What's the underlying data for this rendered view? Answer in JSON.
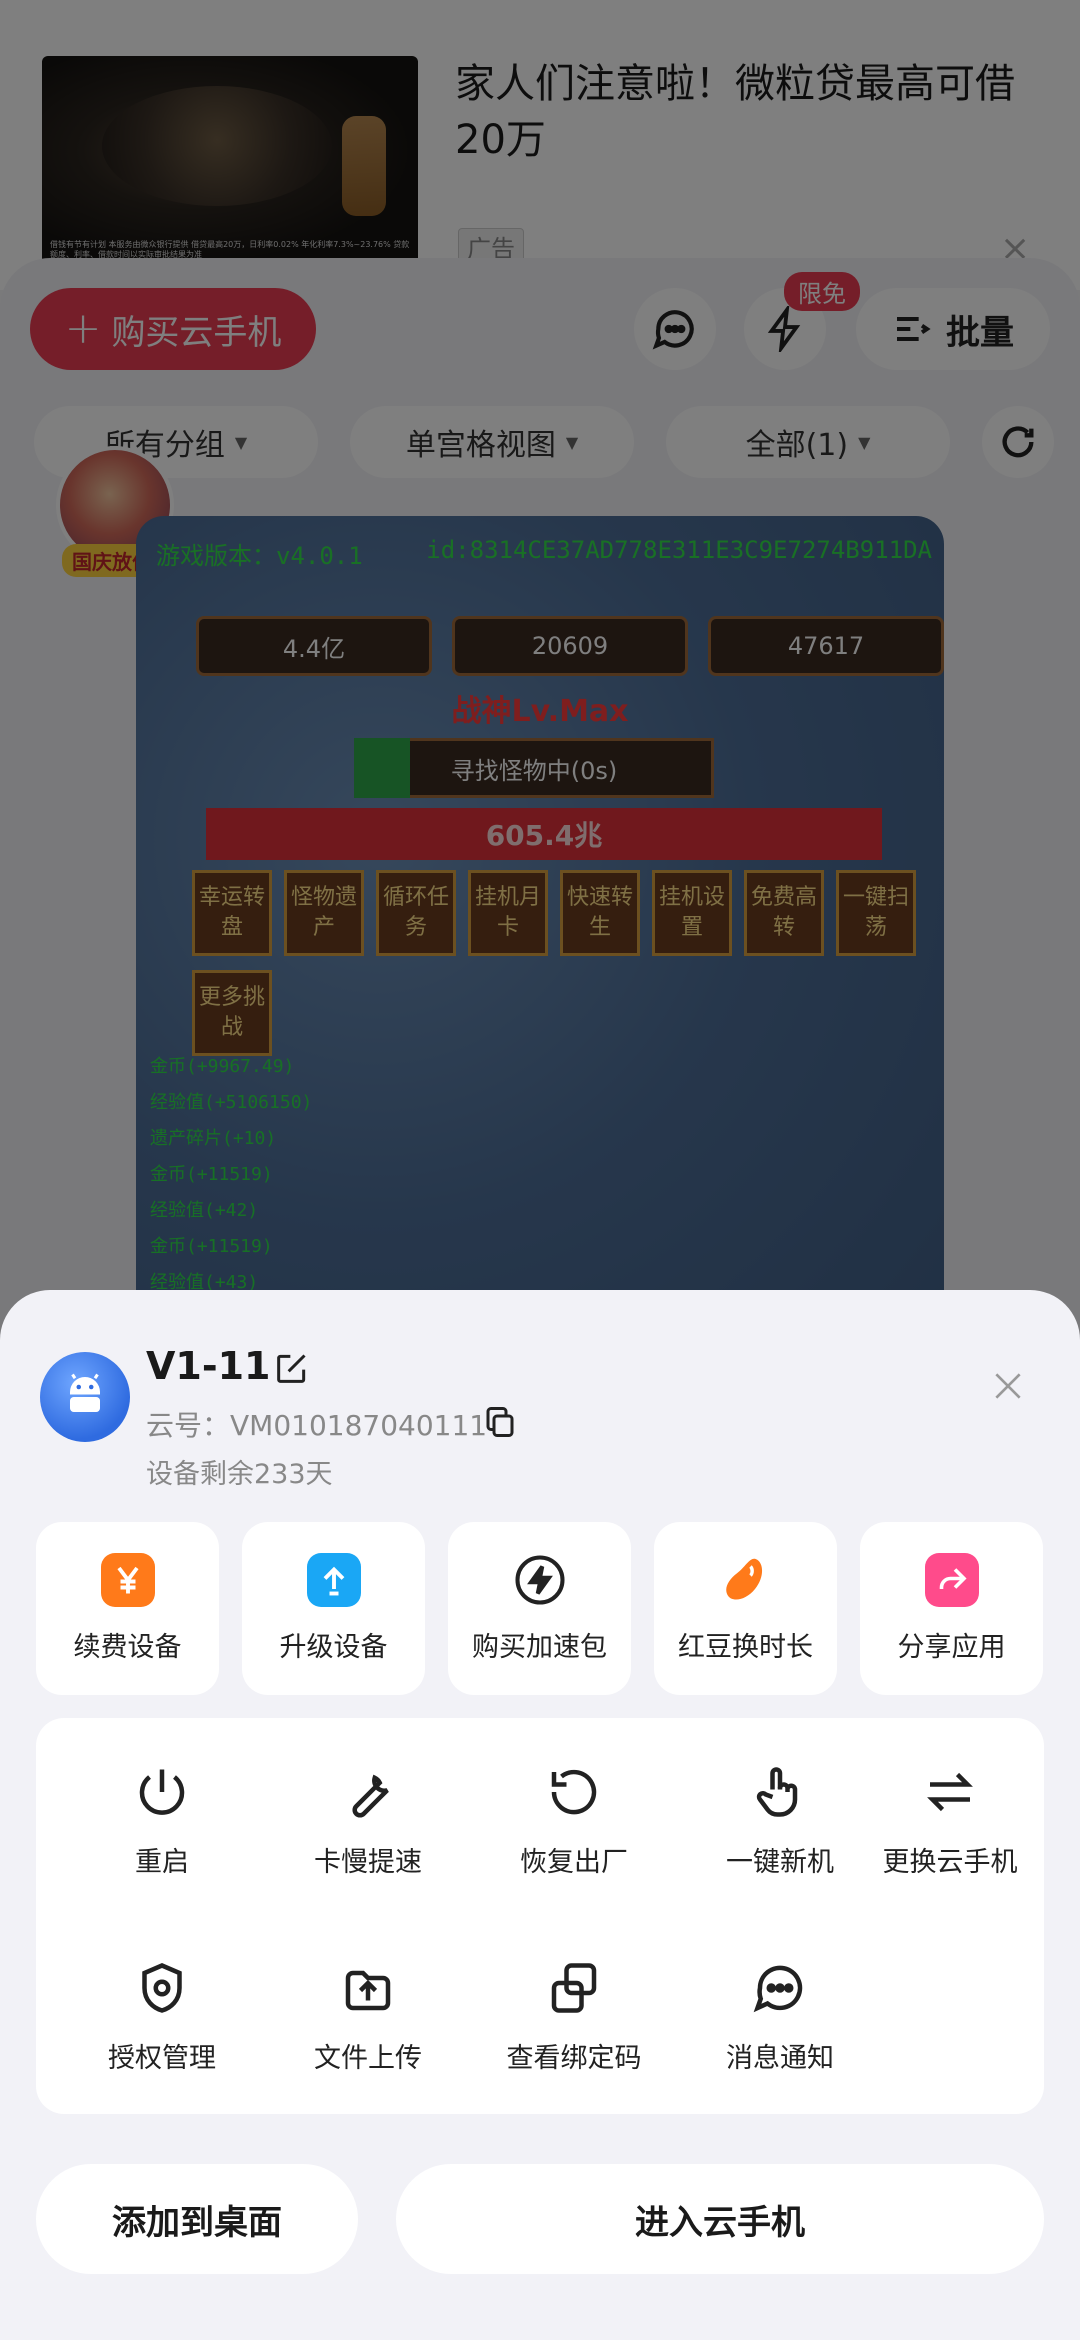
{
  "background": {
    "ad": {
      "title": "家人们注意啦！微粒贷最高可借20万",
      "tag": "广告",
      "close": "×",
      "thumb_caption": "借钱有节有计划 本服务由微众银行提供 借贷最高20万，日利率0.02% 年化利率7.3%~23.76% 贷款额度、利率、借款时间以实际审批结果为准"
    },
    "toolbar": {
      "buy_label": "购买云手机",
      "buy_plus": "+",
      "limited_badge": "限免",
      "batch_label": "批量"
    },
    "filters": [
      {
        "label": "所有分组"
      },
      {
        "label": "单宫格视图"
      },
      {
        "label": "全部(1)"
      }
    ],
    "promo_label": "国庆放价",
    "game": {
      "version": "游戏版本：v4.0.1",
      "id": "id:8314CE37AD778E311E3C9E7274B911DA",
      "resources": [
        "4.4亿",
        "20609",
        "47617"
      ],
      "rank": "战神Lv.Max",
      "seek": "寻找怪物中(0s)",
      "power": "605.4兆",
      "buttons": [
        "幸运转盘",
        "怪物遗产",
        "循环任务",
        "挂机月卡",
        "快速转生",
        "挂机设置",
        "免费高转",
        "一键扫荡",
        "更多挑战"
      ],
      "logs": [
        "金币(+9967.49)",
        "经验值(+5106150)",
        "遗产碎片(+10)",
        "金币(+11519)",
        "经验值(+42)",
        "金币(+11519)",
        "经验值(+43)"
      ]
    }
  },
  "sheet": {
    "device_name": "V1-11",
    "cloud_id": "云号：VM010187040111",
    "remaining": "设备剩余233天",
    "quick_actions": [
      {
        "label": "续费设备",
        "icon": "yen-icon",
        "color": "#ff7a1a"
      },
      {
        "label": "升级设备",
        "icon": "upgrade-icon",
        "color": "#1aa7f5"
      },
      {
        "label": "购买加速包",
        "icon": "lightning-icon",
        "color": "#222222"
      },
      {
        "label": "红豆换时长",
        "icon": "bean-icon",
        "color": "#ff7a1a"
      },
      {
        "label": "分享应用",
        "icon": "share-icon",
        "color": "#ff4b8b"
      }
    ],
    "tools": [
      {
        "label": "重启",
        "icon": "power-icon"
      },
      {
        "label": "卡慢提速",
        "icon": "wrench-icon"
      },
      {
        "label": "恢复出厂",
        "icon": "reset-icon"
      },
      {
        "label": "一键新机",
        "icon": "tap-icon"
      },
      {
        "label": "更换云手机",
        "icon": "swap-icon"
      },
      {
        "label": "授权管理",
        "icon": "shield-icon"
      },
      {
        "label": "文件上传",
        "icon": "upload-icon"
      },
      {
        "label": "查看绑定码",
        "icon": "link-icon"
      },
      {
        "label": "消息通知",
        "icon": "message-icon"
      }
    ],
    "add_to_desktop": "添加到桌面",
    "enter_phone": "进入云手机"
  }
}
